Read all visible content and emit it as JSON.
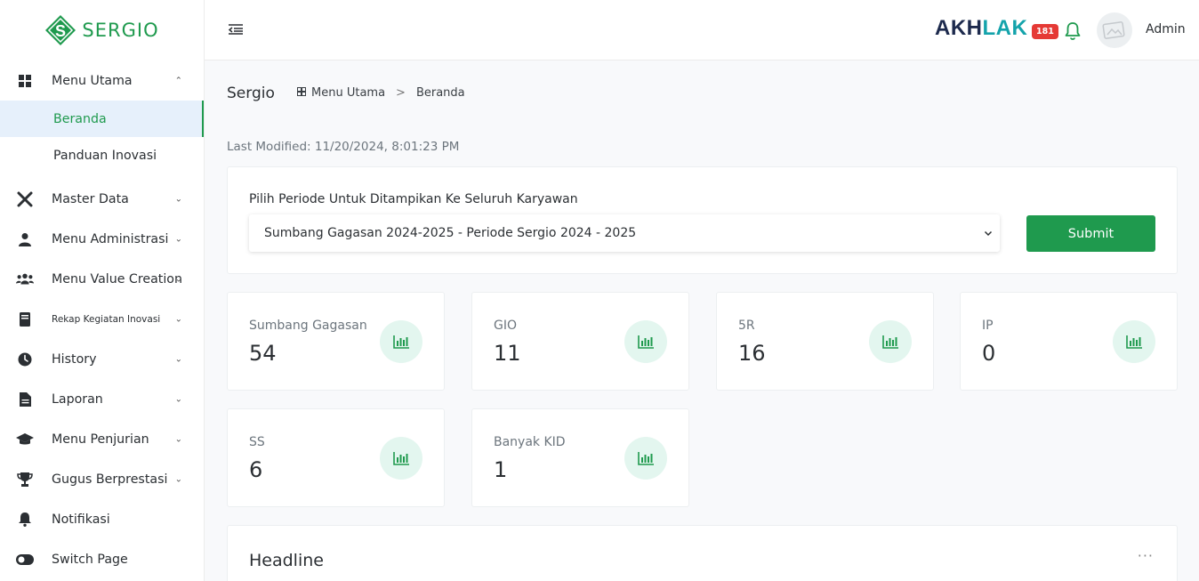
{
  "brand": {
    "name": "SERGIO",
    "color": "#1f9a4e"
  },
  "header": {
    "akhlak_part1": "AKH",
    "akhlak_part2": "LAK",
    "notification_count": "181",
    "user_name": "Admin"
  },
  "sidebar": {
    "menu_utama": {
      "label": "Menu Utama",
      "icon": "grid-icon",
      "expanded": true
    },
    "sub_items": [
      {
        "label": "Beranda",
        "active": true
      },
      {
        "label": "Panduan Inovasi",
        "active": false
      }
    ],
    "items": [
      {
        "label": "Master Data",
        "icon": "tools-icon"
      },
      {
        "label": "Menu Administrasi",
        "icon": "user-icon"
      },
      {
        "label": "Menu Value Creation",
        "icon": "users-icon"
      },
      {
        "label": "Rekap Kegiatan Inovasi",
        "icon": "book-icon"
      },
      {
        "label": "History",
        "icon": "clock-icon"
      },
      {
        "label": "Laporan",
        "icon": "file-icon"
      },
      {
        "label": "Menu Penjurian",
        "icon": "graduation-cap-icon"
      },
      {
        "label": "Gugus Berprestasi",
        "icon": "trophy-icon"
      },
      {
        "label": "Notifikasi",
        "icon": "bell-icon"
      },
      {
        "label": "Switch Page",
        "icon": "toggle-icon"
      }
    ]
  },
  "breadcrumb": {
    "title": "Sergio",
    "parent": "Menu Utama",
    "current": "Beranda",
    "separator": ">"
  },
  "last_modified": "Last Modified: 11/20/2024, 8:01:23 PM",
  "period": {
    "label": "Pilih Periode Untuk Ditampikan Ke Seluruh Karyawan",
    "selected": "Sumbang Gagasan 2024-2025 - Periode Sergio 2024 - 2025",
    "submit_label": "Submit"
  },
  "stats": [
    {
      "label": "Sumbang Gagasan",
      "value": "54"
    },
    {
      "label": "GIO",
      "value": "11"
    },
    {
      "label": "5R",
      "value": "16"
    },
    {
      "label": "IP",
      "value": "0"
    },
    {
      "label": "SS",
      "value": "6"
    },
    {
      "label": "Banyak KID",
      "value": "1"
    }
  ],
  "headline": {
    "title": "Headline",
    "more": "···"
  }
}
